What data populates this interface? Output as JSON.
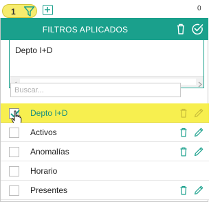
{
  "toolbar": {
    "filter_count": "1",
    "right_value": "0"
  },
  "panel": {
    "title": "FILTROS APLICADOS",
    "applied_filters": [
      "Depto I+D"
    ],
    "search": {
      "placeholder": "Buscar...",
      "value": ""
    }
  },
  "filters": [
    {
      "label": "Depto I+D",
      "checked": true,
      "selected": true,
      "editable": true,
      "deletable": true
    },
    {
      "label": "Activos",
      "checked": false,
      "selected": false,
      "editable": true,
      "deletable": true
    },
    {
      "label": "Anomalías",
      "checked": false,
      "selected": false,
      "editable": true,
      "deletable": true
    },
    {
      "label": "Horario",
      "checked": false,
      "selected": false,
      "editable": false,
      "deletable": false
    },
    {
      "label": "Presentes",
      "checked": false,
      "selected": false,
      "editable": true,
      "deletable": true
    }
  ],
  "colors": {
    "accent": "#1aa08c",
    "highlight": "#f7ef4f",
    "badge": "#f7ec6e"
  },
  "icons": {
    "filter": "funnel-icon",
    "add": "plus-square-icon",
    "trash": "trash-icon",
    "clear": "check-circle-icon",
    "edit": "pencil-icon"
  }
}
